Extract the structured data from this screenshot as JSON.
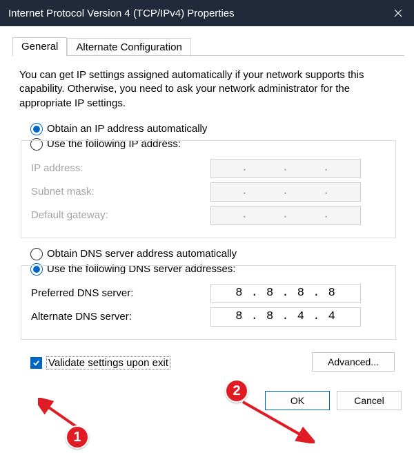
{
  "window": {
    "title": "Internet Protocol Version 4 (TCP/IPv4) Properties"
  },
  "tabs": {
    "general": "General",
    "alternate": "Alternate Configuration"
  },
  "description": "You can get IP settings assigned automatically if your network supports this capability. Otherwise, you need to ask your network administrator for the appropriate IP settings.",
  "ip": {
    "auto_label": "Obtain an IP address automatically",
    "manual_label": "Use the following IP address:",
    "ip_label": "IP address:",
    "mask_label": "Subnet mask:",
    "gateway_label": "Default gateway:",
    "ip_value": "",
    "mask_value": "",
    "gateway_value": ""
  },
  "dns": {
    "auto_label": "Obtain DNS server address automatically",
    "manual_label": "Use the following DNS server addresses:",
    "pref_label": "Preferred DNS server:",
    "alt_label": "Alternate DNS server:",
    "pref_value": "8 . 8 . 8 . 8",
    "alt_value": "8 . 8 . 4 . 4"
  },
  "validate_label": "Validate settings upon exit",
  "buttons": {
    "advanced": "Advanced...",
    "ok": "OK",
    "cancel": "Cancel"
  },
  "annotations": {
    "badge1": "1",
    "badge2": "2"
  }
}
